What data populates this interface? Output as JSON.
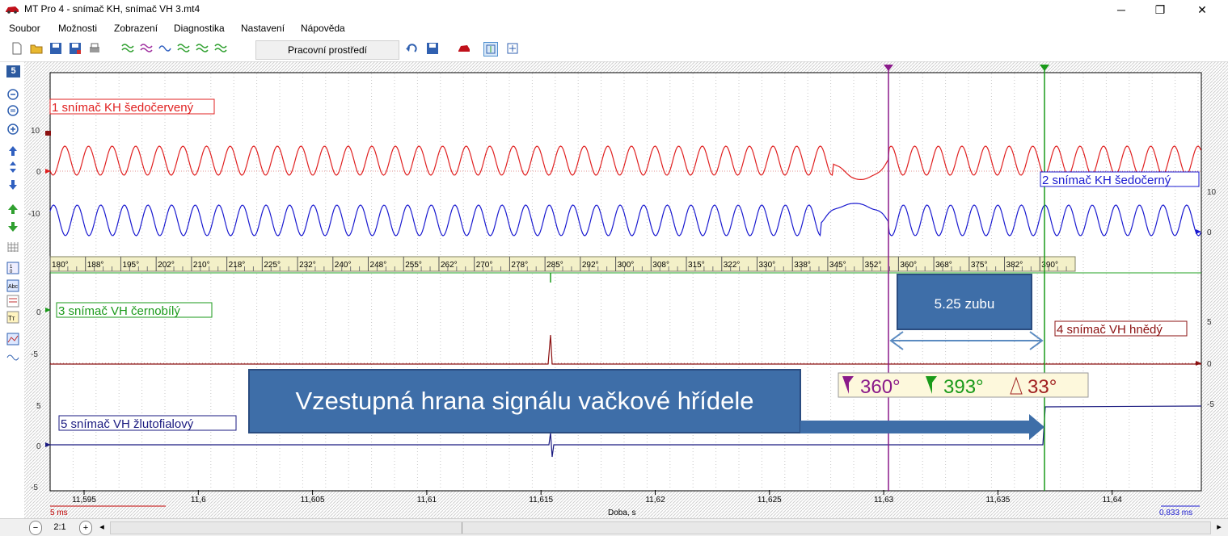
{
  "window": {
    "title": "MT Pro 4 - snímač KH, snímač VH 3.mt4",
    "minimize": "─",
    "restore": "❐",
    "close": "✕"
  },
  "menu": [
    "Soubor",
    "Možnosti",
    "Zobrazení",
    "Diagnostika",
    "Nastavení",
    "Nápověda"
  ],
  "toolbar": {
    "env_label": "Pracovní prostředí"
  },
  "left_panel": {
    "page_number": "5"
  },
  "channels": [
    {
      "label": "1 snímač KH šedočervený",
      "color": "#e02020"
    },
    {
      "label": "2 snímač KH šedočerný",
      "color": "#1a1ad0"
    },
    {
      "label": "3 snímač VH černobílý",
      "color": "#1a9a1a"
    },
    {
      "label": "4 snímač VH hnědý",
      "color": "#8b1010"
    },
    {
      "label": "5 snímač VH žlutofialový",
      "color": "#1a1a80"
    }
  ],
  "left_scale_top": [
    "10",
    "0",
    "-10"
  ],
  "left_scale_bottom": [
    "0",
    "-5",
    "5",
    "0",
    "-5"
  ],
  "right_scale_top": [
    "10",
    "0"
  ],
  "right_scale_bottom": [
    "5",
    "0",
    "-5"
  ],
  "degree_ruler": [
    "180°",
    "188°",
    "195°",
    "202°",
    "210°",
    "218°",
    "225°",
    "232°",
    "240°",
    "248°",
    "255°",
    "262°",
    "270°",
    "278°",
    "285°",
    "292°",
    "300°",
    "308°",
    "315°",
    "322°",
    "330°",
    "338°",
    "345°",
    "352°",
    "360°",
    "368°",
    "375°",
    "382°",
    "390°"
  ],
  "x_axis": {
    "ticks": [
      "11,595",
      "11,6",
      "11,605",
      "11,61",
      "11,615",
      "11,62",
      "11,625",
      "11,63",
      "11,635",
      "11,64"
    ],
    "label": "Doba, s",
    "left_scale": "5 ms",
    "right_scale": "0,833 ms"
  },
  "cursors": {
    "cursor1_value": "360°",
    "cursor2_value": "393°",
    "delta_value": "33°",
    "cursor1_color": "#8a1a8a",
    "cursor2_color": "#1a9a1a"
  },
  "annotations": {
    "teeth_label": "5.25 zubu",
    "edge_label": "Vzestupná hrana signálu vačkové hřídele",
    "box_color": "#3e6ea8"
  },
  "statusbar": {
    "zoom": "2:1"
  }
}
